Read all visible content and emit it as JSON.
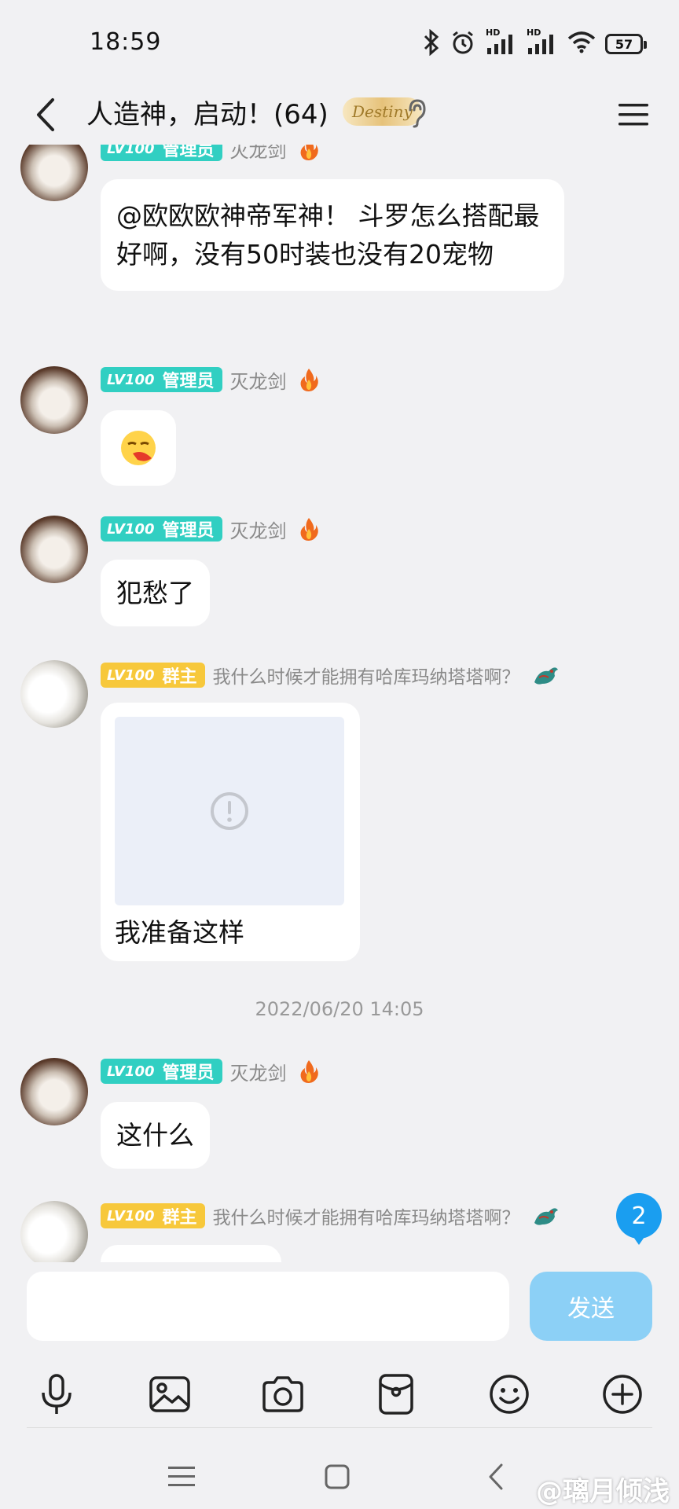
{
  "status_bar": {
    "time": "18:59",
    "hd1": "HD",
    "hd2": "HD",
    "battery": "57"
  },
  "header": {
    "title": "人造神，启动！(64)",
    "badge_text": "Destiny"
  },
  "messages": [
    {
      "level": "LV100",
      "role": "管理员",
      "nick": "灭龙剑",
      "text": "@欧欧欧神帝军神！ 斗罗怎么搭配最好啊，没有50时装也没有20宠物"
    },
    {
      "level": "LV100",
      "role": "管理员",
      "nick": "灭龙剑",
      "emoji": "😤"
    },
    {
      "level": "LV100",
      "role": "管理员",
      "nick": "灭龙剑",
      "text": "犯愁了"
    },
    {
      "level": "LV100",
      "role": "群主",
      "nick": "我什么时候才能拥有哈库玛纳塔塔啊？",
      "caption": "我准备这样"
    },
    {
      "level": "LV100",
      "role": "管理员",
      "nick": "灭龙剑",
      "text": "这什么"
    },
    {
      "level": "LV100",
      "role": "群主",
      "nick": "我什么时候才能拥有哈库玛纳塔塔啊？"
    }
  ],
  "timestamp": "2022/06/20 14:05",
  "unread_count": "2",
  "input": {
    "placeholder": "",
    "send_label": "发送"
  },
  "watermark": "@璃月倾浅",
  "colors": {
    "admin_badge": "#31cfc2",
    "owner_badge": "#f7c83b",
    "send_button": "#8cd0f6",
    "unread": "#1a9ef0"
  }
}
